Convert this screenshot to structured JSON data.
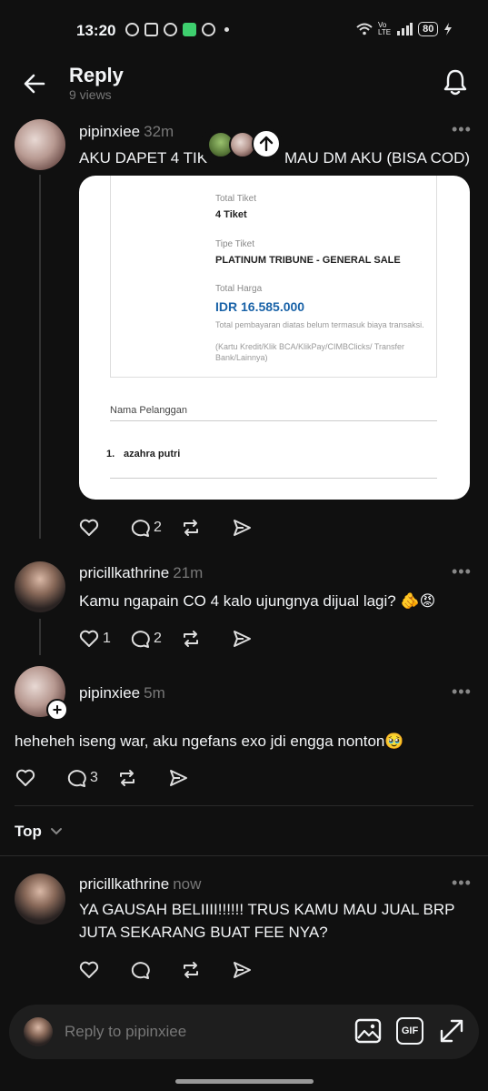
{
  "status_bar": {
    "time": "13:20",
    "battery": "80"
  },
  "header": {
    "title": "Reply",
    "views": "9 views"
  },
  "posts": [
    {
      "username": "pipinxiee",
      "time": "32m",
      "text_left": "AKU DAPET 4 TIK",
      "text_right": "MAU DM AKU (BISA COD)",
      "card": {
        "total_tiket_label": "Total Tiket",
        "total_tiket_value": "4 Tiket",
        "tipe_label": "Tipe Tiket",
        "tipe_value": "PLATINUM TRIBUNE - GENERAL SALE",
        "harga_label": "Total Harga",
        "harga_value": "IDR 16.585.000",
        "note": "Total pembayaran diatas belum termasuk biaya transaksi.",
        "note2": "(Kartu Kredit/Klik BCA/KlikPay/CIMBClicks/ Transfer Bank/Lainnya)",
        "pelanggan_label": "Nama Pelanggan",
        "pelanggan_num": "1.",
        "pelanggan_name": "azahra putri"
      },
      "reply_count": "2"
    },
    {
      "username": "pricillkathrine",
      "time": "21m",
      "text": "Kamu ngapain CO 4 kalo ujungnya dijual lagi? 🫵😡",
      "like_count": "1",
      "reply_count": "2"
    },
    {
      "username": "pipinxiee",
      "time": "5m",
      "text": "heheheh iseng war, aku ngefans exo jdi engga nonton🥹",
      "reply_count": "3"
    },
    {
      "username": "pricillkathrine",
      "time": "now",
      "text": "YA GAUSAH BELIIII!!!!!! TRUS KAMU MAU JUAL BRP JUTA SEKARANG BUAT FEE NYA?"
    }
  ],
  "filter": {
    "label": "Top"
  },
  "composer": {
    "placeholder": "Reply to pipinxiee",
    "gif_label": "GIF"
  }
}
